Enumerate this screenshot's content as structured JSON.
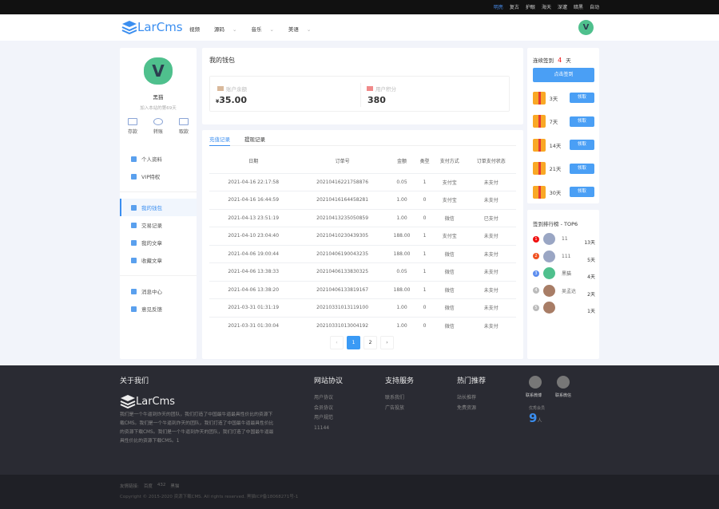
{
  "topbar": {
    "themes": [
      "明亮",
      "复古",
      "护眼",
      "海天",
      "深邃",
      "暗黑",
      "自动"
    ],
    "active": "明亮"
  },
  "header": {
    "logo": "LarCms",
    "nav": [
      "视频",
      "源码",
      "音乐",
      "美语"
    ],
    "avatar_letter": "V"
  },
  "profile": {
    "avatar_letter": "V",
    "name": "黑猫",
    "joined": "加入本站的第69天",
    "actions": [
      "存款",
      "转账",
      "取款"
    ]
  },
  "sidebar": {
    "groups": [
      [
        "个人资料",
        "VIP特权"
      ],
      [
        "我的钱包",
        "交易记录",
        "我的文章",
        "收藏文章"
      ],
      [
        "消息中心",
        "意见反馈"
      ]
    ],
    "active": "我的钱包"
  },
  "wallet": {
    "title": "我的钱包",
    "balance_label": "账户余额",
    "currency": "¥",
    "balance": "35.00",
    "points_label": "用户积分",
    "points": "380"
  },
  "records": {
    "tabs": [
      "充值记录",
      "提现记录"
    ],
    "active_tab": "充值记录",
    "columns": [
      "日期",
      "订单号",
      "金额",
      "类型",
      "支付方式",
      "订单支付状态"
    ],
    "rows": [
      [
        "2021-04-16 22:17:58",
        "20210416221758876",
        "0.05",
        "1",
        "支付宝",
        "未支付"
      ],
      [
        "2021-04-16 16:44:59",
        "20210416164458281",
        "1.00",
        "0",
        "支付宝",
        "未支付"
      ],
      [
        "2021-04-13 23:51:19",
        "20210413235050859",
        "1.00",
        "0",
        "微信",
        "已支付"
      ],
      [
        "2021-04-10 23:04:40",
        "20210410230439305",
        "188.00",
        "1",
        "支付宝",
        "未支付"
      ],
      [
        "2021-04-06 19:00:44",
        "20210406190043235",
        "188.00",
        "1",
        "微信",
        "未支付"
      ],
      [
        "2021-04-06 13:38:33",
        "20210406133830325",
        "0.05",
        "1",
        "微信",
        "未支付"
      ],
      [
        "2021-04-06 13:38:20",
        "20210406133819167",
        "188.00",
        "1",
        "微信",
        "未支付"
      ],
      [
        "2021-03-31 01:31:19",
        "20210331013119100",
        "1.00",
        "0",
        "微信",
        "未支付"
      ],
      [
        "2021-03-31 01:30:04",
        "20210331013004192",
        "1.00",
        "0",
        "微信",
        "未支付"
      ]
    ],
    "pagination": {
      "prev": "‹",
      "pages": [
        "1",
        "2"
      ],
      "current": "1",
      "next": "›"
    }
  },
  "sign": {
    "label": "连续签到",
    "days": "4",
    "unit": "天",
    "button": "点击签到",
    "rewards": [
      {
        "day": "3天",
        "btn": "领取"
      },
      {
        "day": "7天",
        "btn": "领取"
      },
      {
        "day": "14天",
        "btn": "领取"
      },
      {
        "day": "21天",
        "btn": "领取"
      },
      {
        "day": "30天",
        "btn": "领取"
      }
    ]
  },
  "rank": {
    "title": "签到排行榜 - TOP6",
    "items": [
      {
        "no": "1",
        "name": "11",
        "days": "13天",
        "color": "#f01010"
      },
      {
        "no": "2",
        "name": "111",
        "days": "5天",
        "color": "#f05020"
      },
      {
        "no": "3",
        "name": "黑猫",
        "days": "4天",
        "color": "#5b8def"
      },
      {
        "no": "4",
        "name": "吴孟达",
        "days": "2天",
        "color": "#bbbbbb"
      },
      {
        "no": "5",
        "name": "",
        "days": "1天",
        "color": "#bbbbbb"
      }
    ]
  },
  "footer": {
    "about_title": "关于我们",
    "logo": "LarCms",
    "about_text": "我们是一个牛逼到炸天的团队，我们打造了中国最牛逼最具性价比的资源下载CMS。我们是一个牛逼到炸天的团队，我们打造了中国最牛逼最具性价比的资源下载CMS。我们是一个牛逼到炸天的团队，我们打造了中国最牛逼最具性价比的资源下载CMS。1",
    "cols": [
      {
        "title": "网站协议",
        "links": [
          "用户协议",
          "会员协议",
          "用户规范",
          "11144"
        ]
      },
      {
        "title": "支持服务",
        "links": [
          "联系我们",
          "广告投放"
        ]
      },
      {
        "title": "热门推荐",
        "links": [
          "站长推荐",
          "免费资源"
        ]
      }
    ],
    "weibo": "联系微博",
    "wechat": "联系微信",
    "members_label": "优秀会员",
    "members": "9",
    "members_unit": "人",
    "friend_label": "友情链接:",
    "friends": [
      "百度",
      "432",
      "黑猫"
    ],
    "copyright": "Copyright © 2015-2020 资源下载CMS. All rights reserved. 黑猫ICP备18068271号-1"
  }
}
